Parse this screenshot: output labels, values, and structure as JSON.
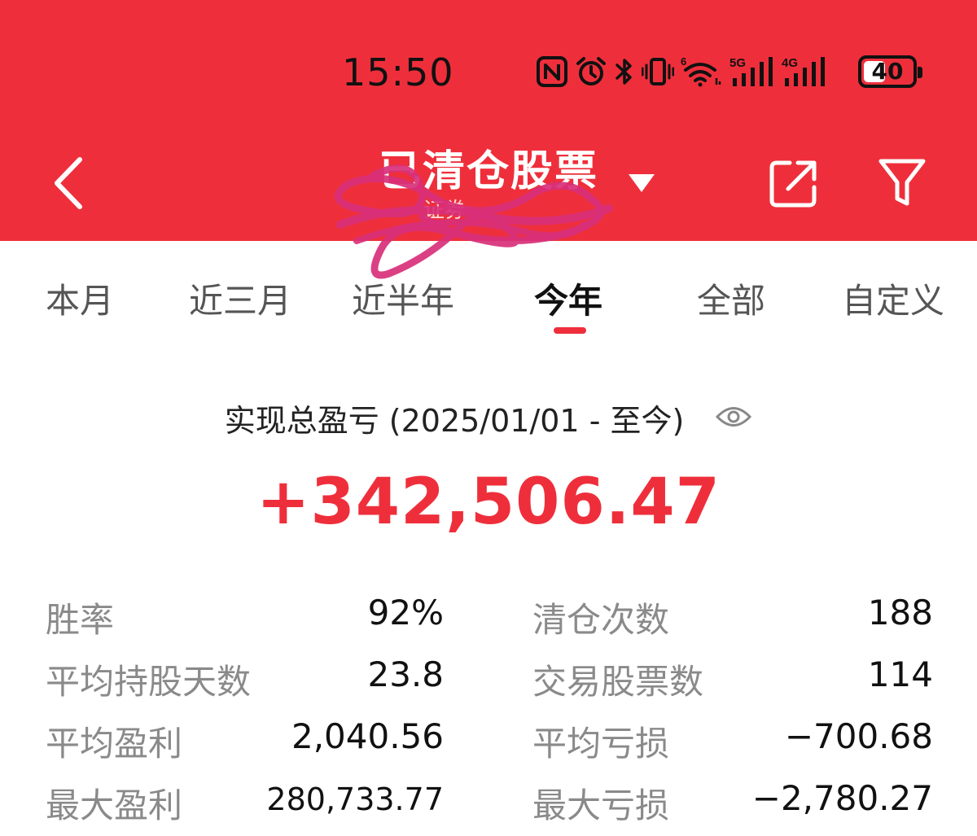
{
  "status_bar": {
    "time": "15:50",
    "icons": [
      "nfc-icon",
      "alarm-icon",
      "bluetooth-icon",
      "vibrate-icon",
      "wifi-6-icon",
      "signal-5g-icon",
      "signal-4g-icon"
    ],
    "wifi_badge": "6",
    "network_1": "5G",
    "network_2": "4G",
    "battery_level": "40"
  },
  "header": {
    "title": "已清仓股票",
    "subtitle": "证券",
    "background": "#ee2f3b"
  },
  "tabs": [
    {
      "label": "本月",
      "active": false
    },
    {
      "label": "近三月",
      "active": false
    },
    {
      "label": "近半年",
      "active": false
    },
    {
      "label": "今年",
      "active": true
    },
    {
      "label": "全部",
      "active": false
    },
    {
      "label": "自定义",
      "active": false
    }
  ],
  "summary": {
    "label": "实现总盈亏 (2025/01/01 - 至今)",
    "value": "+342,506.47",
    "value_color": "#ee2f3b"
  },
  "stats": {
    "left": [
      {
        "label": "胜率",
        "value": "92%"
      },
      {
        "label": "平均持股天数",
        "value": "23.8"
      },
      {
        "label": "平均盈利",
        "value": "2,040.56"
      },
      {
        "label": "最大盈利",
        "value": "280,733.77"
      }
    ],
    "right": [
      {
        "label": "清仓次数",
        "value": "188"
      },
      {
        "label": "交易股票数",
        "value": "114"
      },
      {
        "label": "平均亏损",
        "value": "−700.68"
      },
      {
        "label": "最大亏损",
        "value": "−2,780.27"
      }
    ]
  }
}
